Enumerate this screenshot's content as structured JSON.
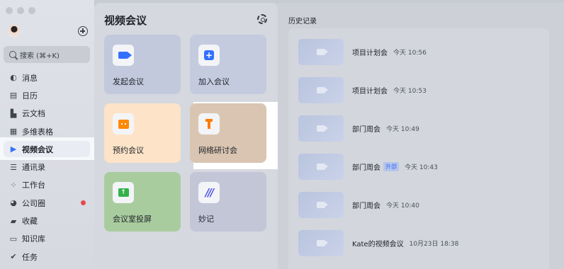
{
  "sidebar": {
    "search_placeholder": "搜索 (⌘+K)",
    "items": [
      {
        "label": "消息",
        "icon": "chat-icon",
        "glyph": "◐"
      },
      {
        "label": "日历",
        "icon": "calendar-icon",
        "glyph": "▤"
      },
      {
        "label": "云文档",
        "icon": "docs-icon",
        "glyph": "▙"
      },
      {
        "label": "多维表格",
        "icon": "table-icon",
        "glyph": "▦"
      },
      {
        "label": "视频会议",
        "icon": "video-icon",
        "glyph": "▶",
        "active": true
      },
      {
        "label": "通讯录",
        "icon": "contacts-icon",
        "glyph": "☰"
      },
      {
        "label": "工作台",
        "icon": "workplace-icon",
        "glyph": "⁘"
      },
      {
        "label": "公司圈",
        "icon": "moments-icon",
        "glyph": "◕",
        "badge": true
      },
      {
        "label": "收藏",
        "icon": "bookmark-icon",
        "glyph": "▰"
      },
      {
        "label": "知识库",
        "icon": "wiki-icon",
        "glyph": "▭"
      },
      {
        "label": "任务",
        "icon": "task-icon",
        "glyph": "✔"
      }
    ]
  },
  "main": {
    "title": "视频会议",
    "cards": [
      {
        "label": "发起会议",
        "icon": "start-meeting-icon"
      },
      {
        "label": "加入会议",
        "icon": "join-meeting-icon"
      },
      {
        "label": "预约会议",
        "icon": "schedule-meeting-icon"
      },
      {
        "label": "网络研讨会",
        "icon": "webinar-icon"
      },
      {
        "label": "会议室投屏",
        "icon": "screen-share-icon"
      },
      {
        "label": "妙记",
        "icon": "minutes-icon"
      }
    ]
  },
  "history": {
    "title": "历史记录",
    "items": [
      {
        "name": "项目计划会",
        "time": "今天 10:56",
        "tag": ""
      },
      {
        "name": "项目计划会",
        "time": "今天 10:53",
        "tag": ""
      },
      {
        "name": "部门周会",
        "time": "今天 10:49",
        "tag": ""
      },
      {
        "name": "部门周会",
        "time": "今天 10:43",
        "tag": "外部"
      },
      {
        "name": "部门周会",
        "time": "今天 10:40",
        "tag": ""
      },
      {
        "name": "Kate的视频会议",
        "time": "10月23日 18:38",
        "tag": ""
      }
    ]
  },
  "colors": {
    "accent": "#3370ff",
    "badge_red": "#e5484d",
    "schedule_card": "#fde3c8",
    "webinar_card": "#d9c5b1",
    "screen_card": "#a9cc9f"
  }
}
